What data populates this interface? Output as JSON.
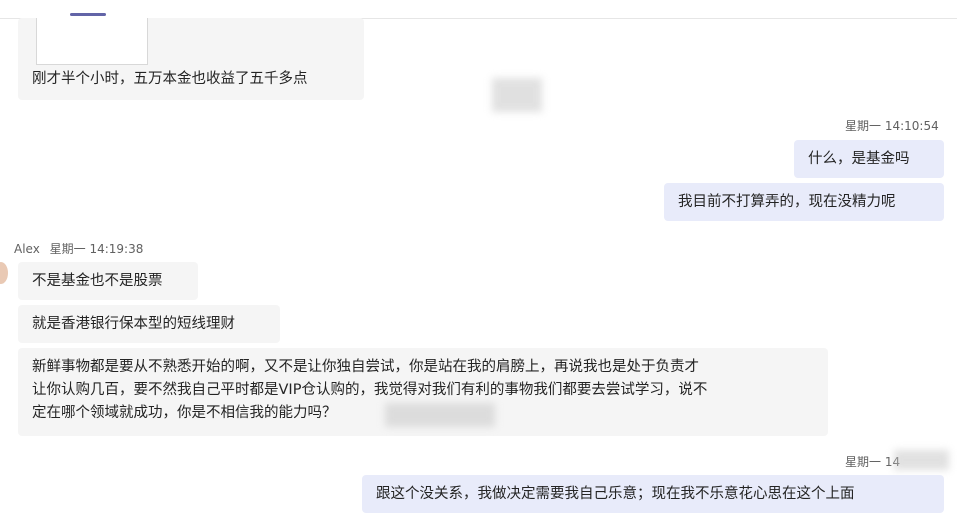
{
  "messages": [
    {
      "text": "刚才半个小时，五万本金也收益了五千多点"
    },
    {
      "meta": "星期一 14:10:54"
    },
    {
      "text": "什么，是基金吗"
    },
    {
      "text": "我目前不打算弄的，现在没精力呢"
    },
    {
      "sender": "Alex",
      "meta": "星期一 14:19:38"
    },
    {
      "text": "不是基金也不是股票"
    },
    {
      "text": "就是香港银行保本型的短线理财"
    },
    {
      "lines": [
        "新鲜事物都是要从不熟悉开始的啊，又不是让你独自尝试，你是站在我的肩膀上，再说我也是处于负责才",
        "让你认购几百，要不然我自己平时都是VIP仓认购的，我觉得对我们有利的事物我们都要去尝试学习，说不",
        "定在哪个领域就成功，你是不相信我的能力吗？"
      ]
    },
    {
      "meta": "星期一 14"
    },
    {
      "text": "跟这个没关系，我做决定需要我自己乐意；现在我不乐意花心思在这个上面"
    }
  ],
  "colors": {
    "accent": "#6264a7",
    "incoming_bubble": "#f5f5f5",
    "outgoing_bubble": "#e8ebfa"
  }
}
